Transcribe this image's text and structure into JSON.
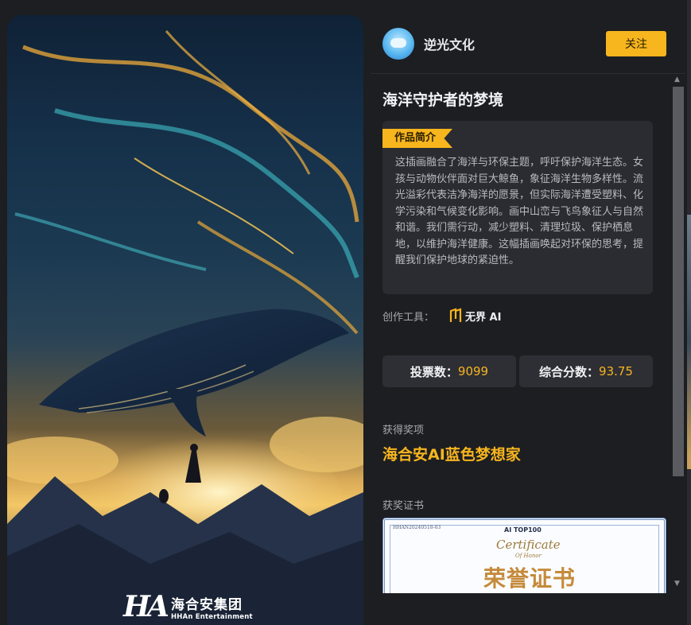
{
  "artwork": {
    "logo_mark": "HA",
    "logo_cn": "海合安集团",
    "logo_en": "HHAn Entertainment"
  },
  "author": {
    "name": "逆光文化",
    "follow_label": "关注"
  },
  "work": {
    "title": "海洋守护者的梦境",
    "intro_tag": "作品简介",
    "description": "这插画融合了海洋与环保主题，呼吁保护海洋生态。女孩与动物伙伴面对巨大鲸鱼，象征海洋生物多样性。流光溢彩代表洁净海洋的愿景，但实际海洋遭受塑料、化学污染和气候变化影响。画中山峦与飞鸟象征人与自然和谐。我们需行动，减少塑料、清理垃圾、保护栖息地，以维护海洋健康。这幅插画唤起对环保的思考，提醒我们保护地球的紧迫性。",
    "tools_label": "创作工具：",
    "tool_name": "无界 AI"
  },
  "stats": {
    "votes_label": "投票数：",
    "votes_value": "9099",
    "score_label": "综合分数：",
    "score_value": "93.75"
  },
  "award": {
    "label": "获得奖项",
    "name": "海合安AI蓝色梦想家"
  },
  "certificate": {
    "label": "获奖证书",
    "id": "HHAN20240518-03",
    "top_text": "AI TOP100",
    "title_en": "Certificate",
    "subtitle_en": "Of Honor",
    "title_cn": "荣誉证书"
  },
  "colors": {
    "accent": "#f7b51e",
    "panel_bg": "#1d1e22",
    "card_bg": "#2b2c32"
  },
  "icons": {
    "scroll_up": "▲",
    "scroll_down": "▼"
  }
}
